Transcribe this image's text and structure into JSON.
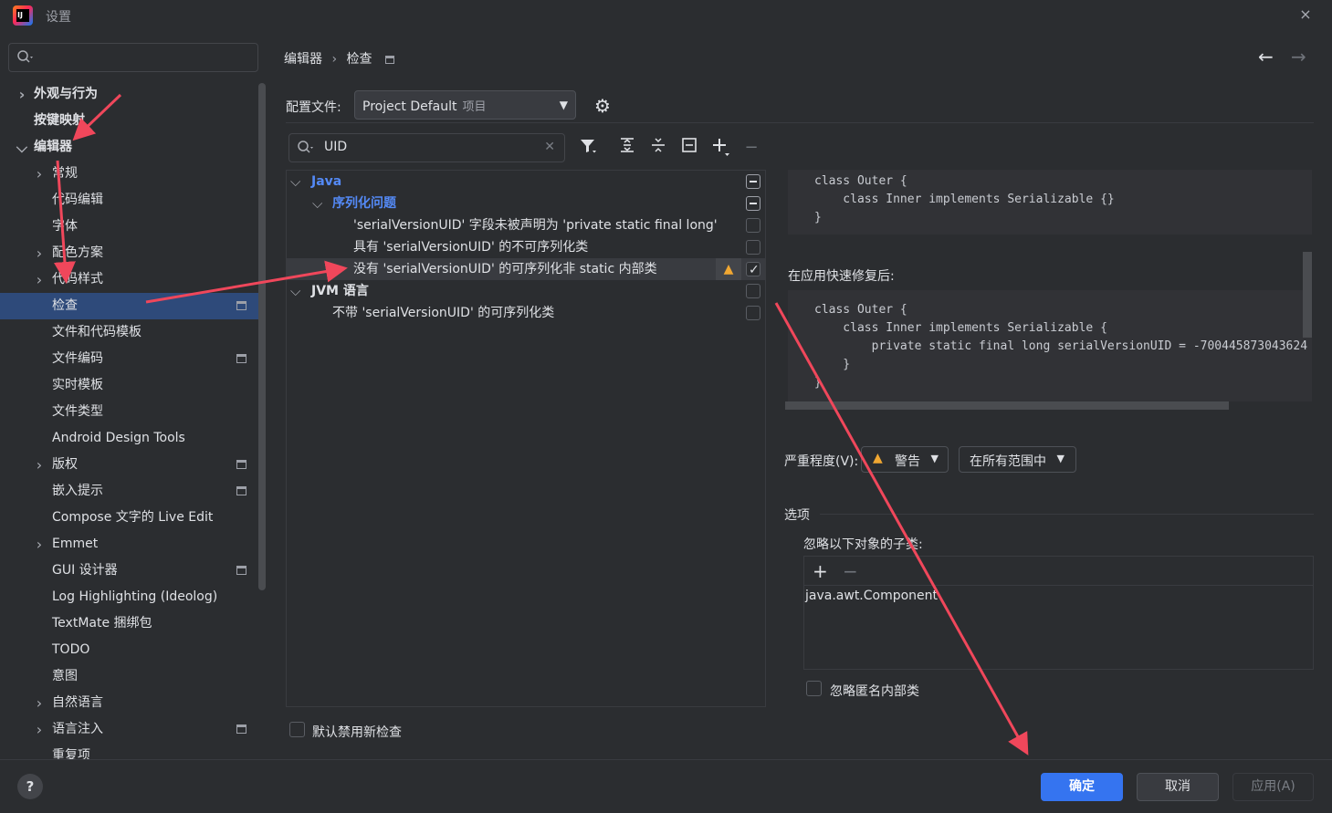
{
  "window": {
    "title": "设置",
    "close_icon": "×"
  },
  "sidebar": {
    "search_value": "",
    "items": [
      {
        "label": "外观与行为",
        "chevron": "›",
        "bold": true
      },
      {
        "label": "按键映射",
        "bold": true
      },
      {
        "label": "编辑器",
        "chevron": "⌄",
        "bold": true
      },
      {
        "label": "常规",
        "chevron": "›"
      },
      {
        "label": "代码编辑"
      },
      {
        "label": "字体"
      },
      {
        "label": "配色方案",
        "chevron": "›"
      },
      {
        "label": "代码样式",
        "chevron": "›"
      },
      {
        "label": "检查",
        "selected": true,
        "modified": true
      },
      {
        "label": "文件和代码模板"
      },
      {
        "label": "文件编码",
        "modified": true
      },
      {
        "label": "实时模板"
      },
      {
        "label": "文件类型"
      },
      {
        "label": "Android Design Tools"
      },
      {
        "label": "版权",
        "chevron": "›",
        "modified": true
      },
      {
        "label": "嵌入提示",
        "modified": true
      },
      {
        "label": "Compose 文字的 Live Edit"
      },
      {
        "label": "Emmet",
        "chevron": "›"
      },
      {
        "label": "GUI 设计器",
        "modified": true
      },
      {
        "label": "Log Highlighting (Ideolog)"
      },
      {
        "label": "TextMate 捆绑包"
      },
      {
        "label": "TODO"
      },
      {
        "label": "意图"
      },
      {
        "label": "自然语言",
        "chevron": "›"
      },
      {
        "label": "语言注入",
        "chevron": "›",
        "modified": true
      },
      {
        "label": "重复项"
      }
    ]
  },
  "breadcrumb": {
    "parent": "编辑器",
    "separator": "›",
    "current": "检查"
  },
  "profile": {
    "label": "配置文件:",
    "value": "Project Default",
    "sub": "项目"
  },
  "filter": {
    "value": "UID"
  },
  "inspections": [
    {
      "label": "Java",
      "style": "link",
      "chevron": "⌄",
      "check": "partial"
    },
    {
      "label": "序列化问题",
      "style": "link",
      "chevron": "⌄",
      "check": "partial"
    },
    {
      "label": "'serialVersionUID' 字段未被声明为 'private static final long'",
      "check": "off"
    },
    {
      "label": "具有 'serialVersionUID' 的不可序列化类",
      "check": "off"
    },
    {
      "label": "没有 'serialVersionUID' 的可序列化非 static 内部类",
      "check": "on",
      "selected": true,
      "warning": true
    },
    {
      "label": "JVM 语言",
      "style": "bold",
      "chevron": "⌄",
      "check": "off"
    },
    {
      "label": "不带 'serialVersionUID' 的可序列化类",
      "check": "off"
    }
  ],
  "default_disable_label": "默认禁用新检查",
  "code_before": "class Outer {\n    class Inner implements Serializable {}\n}",
  "after_fix_label": "在应用快速修复后:",
  "code_after": "class Outer {\n    class Inner implements Serializable {\n        private static final long serialVersionUID = -700445873043624\n    }\n}",
  "severity": {
    "label": "严重程度(V):",
    "value": "警告",
    "scope": "在所有范围中"
  },
  "options": {
    "section_label": "选项",
    "ignore_label": "忽略以下对象的子类:",
    "ignore_items": [
      "java.awt.Component"
    ],
    "anon_label": "忽略匿名内部类"
  },
  "footer": {
    "help": "?",
    "ok": "确定",
    "cancel": "取消",
    "apply": "应用(A)"
  },
  "colors": {
    "accent": "#3574f0",
    "selection": "#2e4a7a",
    "annotation": "#f0475b",
    "warning": "#f0a732",
    "link": "#548af7"
  }
}
